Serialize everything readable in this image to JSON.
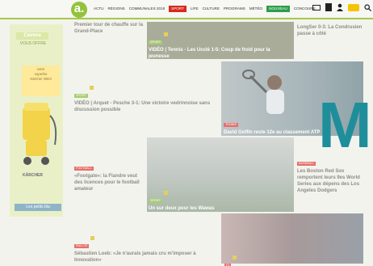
{
  "logo": {
    "glyph": "a."
  },
  "nav": {
    "items": [
      "ACTU",
      "RÉGIONS",
      "COMMUNALES 2018",
      "SPORT",
      "LIFE",
      "CULTURE",
      "PROGRAMS",
      "MÉTÉO",
      "NOUVEAU",
      "CONCOURS"
    ]
  },
  "sidebar": {
    "brand_tag": "Cavena",
    "brand_sub": "VOUS OFFRE",
    "note": "votre\nsuperbe\nKärcher WD3",
    "product_brand": "KÄRCHER",
    "cta": "Les petits bla"
  },
  "articles": [
    {
      "id": "a1",
      "title": "Premier tour de chauffe sur la Grand-Place",
      "category": "",
      "badge": false
    },
    {
      "id": "a2",
      "title": "VIDÉO | Tennis - Les Ucclé 1-5: Coup de froid pour la jeunesse",
      "category": "SPORT",
      "badge": true
    },
    {
      "id": "a3",
      "title": "LongSer 0-3: La Condrusien passe à côté",
      "category": "",
      "badge": false
    },
    {
      "id": "a4",
      "title": "VIDÉO | Arquet - Pesche 3-1: Une victoire vedrinnoise sans discussion possible",
      "category": "SPORT",
      "badge": true
    },
    {
      "id": "a5",
      "title": "David Goffin reste 12e au classement ATP",
      "category": "TENNIS",
      "badge": false
    },
    {
      "id": "a6",
      "title": "«Footgate»: la Flandre veut des licences pour le football amateur",
      "category": "FOOTBALL",
      "badge": false
    },
    {
      "id": "a7",
      "title": "Un sur deux pour les Wawas",
      "category": "SPORT",
      "badge": true
    },
    {
      "id": "a8",
      "title": "Les Boston Red Sox remportent leurs 9es World Series aux dépens des Los Angeles Dodgers",
      "category": "BASEBALL",
      "badge": false
    },
    {
      "id": "a9",
      "title": "Sébastien Loeb: «Je n'aurais jamais cru m'imposer à Innovation»",
      "category": "RALLYE",
      "badge": true
    },
    {
      "id": "a10",
      "title": "",
      "category": "F1",
      "badge": true
    }
  ],
  "big_letter": "M",
  "colors": {
    "accent_green": "#93c23c",
    "sport_red": "#d52b1e",
    "teal": "#1f8e9b"
  }
}
